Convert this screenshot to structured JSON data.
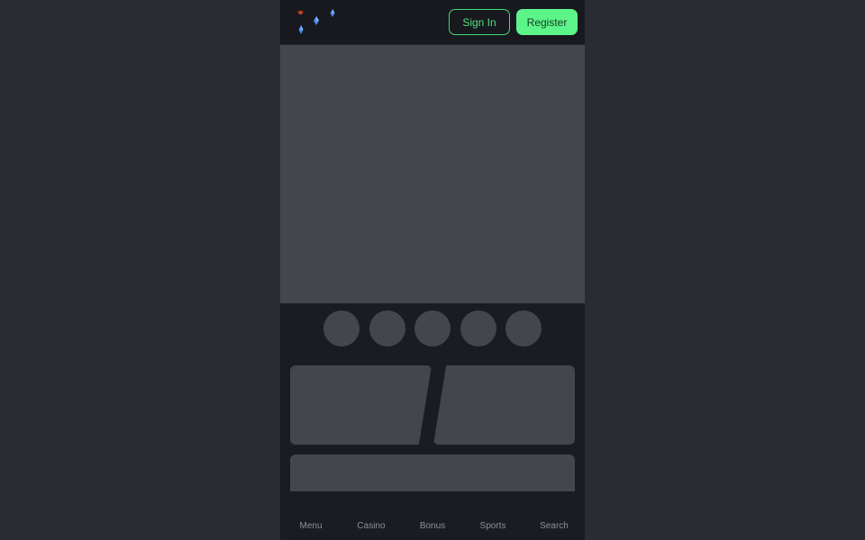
{
  "header": {
    "logo_icon": "gem-logo-icon",
    "signin_label": "Sign In",
    "register_label": "Register"
  },
  "bottom_nav": {
    "items": [
      {
        "label": "Menu"
      },
      {
        "label": "Casino"
      },
      {
        "label": "Bonus"
      },
      {
        "label": "Sports"
      },
      {
        "label": "Search"
      }
    ]
  },
  "colors": {
    "page_background": "#2a2b33",
    "app_background": "#1b1c23",
    "placeholder": "#45454e",
    "accent_green": "#5cf58a",
    "outline_green": "#3ddc6e",
    "nav_text": "#8e8f9a"
  }
}
